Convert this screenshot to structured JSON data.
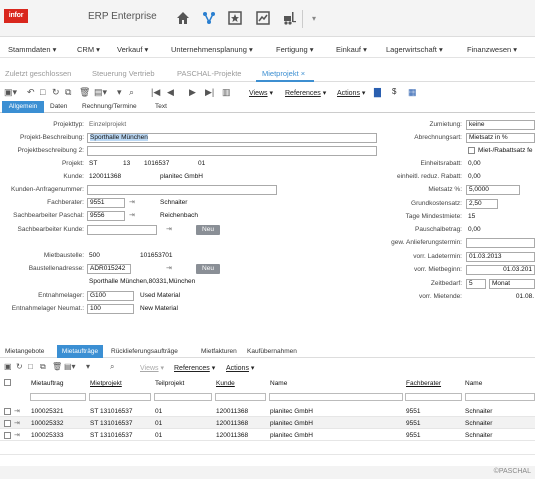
{
  "header": {
    "logo": "infor",
    "title": "ERP Enterprise"
  },
  "menu": [
    "Stammdaten",
    "CRM",
    "Verkauf",
    "Unternehmensplanung",
    "Fertigung",
    "Einkauf",
    "Lagerwirtschaft",
    "Finanzwesen"
  ],
  "tabs": [
    "Zuletzt geschlossen",
    "Steuerung Vertrieb",
    "PASCHAL-Projekte",
    "Mietprojekt"
  ],
  "active_tab": "Mietprojekt",
  "toolbar": {
    "views": "Views",
    "references": "References",
    "actions": "Actions"
  },
  "subtabs": [
    "Allgemein",
    "Daten",
    "Rechnung/Termine",
    "Text"
  ],
  "form": {
    "projekttyp_l": "Projekttyp:",
    "projekttyp": "Einzelprojekt",
    "beschreibung_l": "Projekt-Beschreibung:",
    "beschreibung": "Sporthalle München",
    "beschreibung2_l": "Projektbeschreibung 2:",
    "projekt_l": "Projekt:",
    "projekt_st": "ST",
    "projekt_13": "13",
    "projekt_nr": "1016537",
    "projekt_01": "01",
    "kunde_l": "Kunde:",
    "kunde_nr": "120011368",
    "kunde_name": "planitec GmbH",
    "anfrage_l": "Kunden-Anfragenummer:",
    "fachberater_l": "Fachberater:",
    "fachberater_nr": "9551",
    "fachberater_name": "Schnaiter",
    "sb_paschal_l": "Sachbearbeiter Paschal:",
    "sb_paschal_nr": "9556",
    "sb_paschal_name": "Reichenbach",
    "sb_kunde_l": "Sachbearbeiter Kunde:",
    "neu1": "Neu",
    "mietbaustelle_l": "Mietbaustelle:",
    "mietbaustelle_a": "500",
    "mietbaustelle_b": "101653701",
    "bauadr_l": "Baustellenadresse:",
    "bauadr": "ADR015242",
    "neu2": "Neu",
    "bauadr_text": "Sporthalle München,80331,München",
    "entnahme_l": "Entnahmelager:",
    "entnahme": "G100",
    "entnahme_t": "Used Material",
    "entnahme_neu_l": "Entnahmelager Neumat.:",
    "entnahme_neu": "100",
    "entnahme_neu_t": "New Material",
    "zumietung_l": "Zumietung:",
    "zumietung": "keine",
    "abrechnung_l": "Abrechnungsart:",
    "abrechnung": "Mietsatz in %",
    "rabatt_cb": "Miet-/Rabattsatz fe",
    "einheitsrabatt_l": "Einheitsrabatt:",
    "einheitsrabatt": "0,00",
    "einh_red_l": "einheitl. reduz. Rabatt:",
    "einh_red": "0,00",
    "mietsatz_l": "Mietsatz %:",
    "mietsatz": "5,0000",
    "grundkosten_l": "Grundkostensatz:",
    "grundkosten": "2,50",
    "tage_l": "Tage Mindestmiete:",
    "tage": "15",
    "pauschal_l": "Pauschalbetrag:",
    "pauschal": "0,00",
    "gew_l": "gew. Anlieferungstermin:",
    "ladetermin_l": "vorr. Ladetermin:",
    "ladetermin": "01.03.2013",
    "mietbeginn_l": "vorr. Mietbeginn:",
    "mietbeginn": "01.03.201",
    "zeitbedarf_l": "Zeitbedarf:",
    "zeitbedarf": "5",
    "zeitbedarf_u": "Monat",
    "mietende_l": "vorr. Mietende:",
    "mietende": "01.08."
  },
  "lower_tabs": [
    "Mietangebote",
    "Mietaufträge",
    "Rücklieferungsaufträge",
    "Mietfakturen",
    "Kaufübernahmen"
  ],
  "lower_toolbar": {
    "views": "Views",
    "references": "References",
    "actions": "Actions"
  },
  "table": {
    "headers": [
      "Mietauftrag",
      "Mietprojekt",
      "Teilprojekt",
      "Kunde",
      "Name",
      "Fachberater",
      "Name"
    ],
    "rows": [
      [
        "100025321",
        "ST 131016537",
        "01",
        "120011368",
        "planitec GmbH",
        "9551",
        "Schnaiter"
      ],
      [
        "100025332",
        "ST 131016537",
        "01",
        "120011368",
        "planitec GmbH",
        "9551",
        "Schnaiter"
      ],
      [
        "100025333",
        "ST 131016537",
        "01",
        "120011368",
        "planitec GmbH",
        "9551",
        "Schnaiter"
      ]
    ]
  },
  "copyright": "©PASCHAL",
  "colors": {
    "accent": "#3b8fd3",
    "brand": "#d9271d"
  }
}
